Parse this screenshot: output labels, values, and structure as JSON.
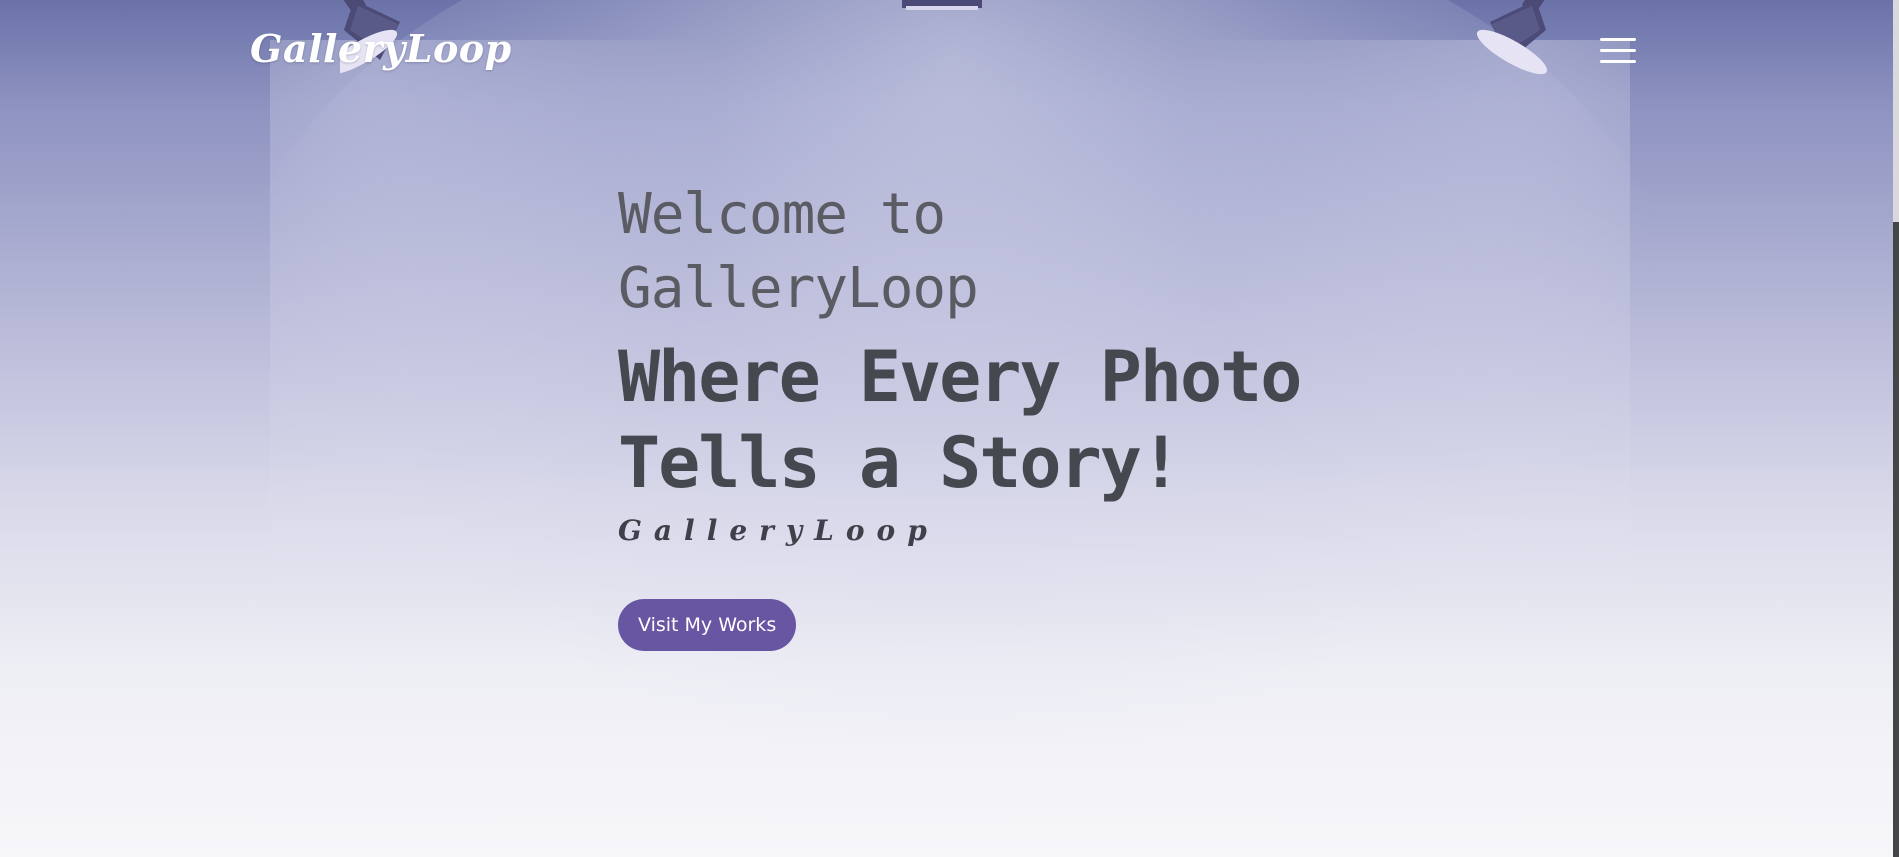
{
  "navbar": {
    "brand": "GalleryLoop",
    "menu_icon": "hamburger-menu-icon"
  },
  "hero": {
    "welcome_line": "Welcome to GalleryLoop",
    "tagline": "Where Every Photo Tells a Story!",
    "subtitle": "GalleryLoop",
    "cta_label": "Visit My Works"
  },
  "decor": {
    "lamp_icon": "spotlight-icon"
  },
  "colors": {
    "accent": "#6956a3",
    "background_top": "#6a72a8",
    "background_bottom": "#f7f7fa"
  }
}
